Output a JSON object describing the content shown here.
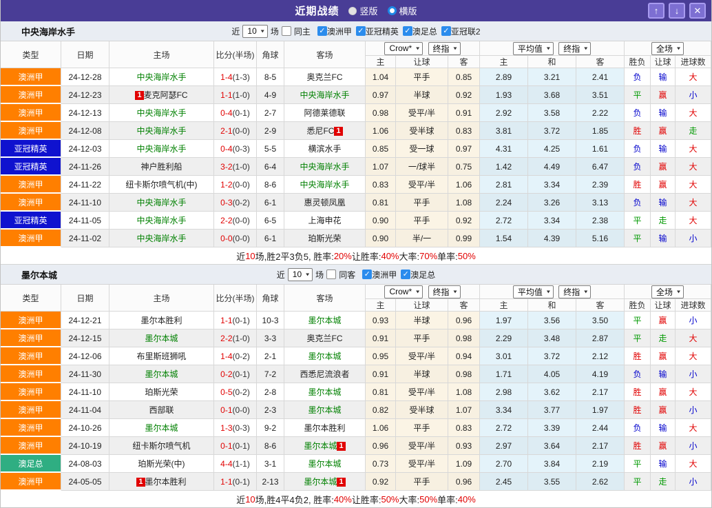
{
  "window": {
    "title": "近期战绩",
    "view_options": [
      {
        "label": "竖版",
        "selected": false
      },
      {
        "label": "横版",
        "selected": true
      }
    ],
    "icons": {
      "up": "↑",
      "down": "↓",
      "close": "✕"
    }
  },
  "table_header": {
    "cols": [
      "类型",
      "日期",
      "主场",
      "比分(半场)",
      "角球",
      "客场"
    ],
    "sub": [
      "主",
      "让球",
      "客",
      "主",
      "和",
      "客",
      "胜负",
      "让球",
      "进球数"
    ],
    "dropdowns": {
      "crow": "Crow*",
      "final1": "终指",
      "avg": "平均值",
      "final2": "终指",
      "full": "全场"
    }
  },
  "sections": [
    {
      "team": "中央海岸水手",
      "filter": {
        "near_label": "近",
        "count": "10",
        "games_label": "场",
        "same_label": "同主",
        "same_checked": false,
        "leagues": [
          {
            "label": "澳洲甲",
            "checked": true
          },
          {
            "label": "亚冠精英",
            "checked": true
          },
          {
            "label": "澳足总",
            "checked": true
          },
          {
            "label": "亚冠联2",
            "checked": true
          }
        ]
      },
      "rows": [
        {
          "lg": "澳洲甲",
          "lc": "orange",
          "date": "24-12-28",
          "h": {
            "n": "中央海岸水手",
            "g": 1
          },
          "s": "1-4",
          "hf": "(1-3)",
          "cn": "8-5",
          "a": {
            "n": "奥克兰FC"
          },
          "od": [
            "1.04",
            "平手",
            "0.85"
          ],
          "av": [
            "2.89",
            "3.21",
            "2.41"
          ],
          "rs": [
            [
              "负",
              "b"
            ],
            [
              "输",
              "b"
            ],
            [
              "大",
              "r"
            ]
          ]
        },
        {
          "lg": "澳洲甲",
          "lc": "orange",
          "date": "24-12-23",
          "h": {
            "n": "麦克阿瑟FC",
            "cb": "1"
          },
          "s": "1-1",
          "hf": "(1-0)",
          "cn": "4-9",
          "a": {
            "n": "中央海岸水手",
            "g": 1
          },
          "od": [
            "0.97",
            "半球",
            "0.92"
          ],
          "av": [
            "1.93",
            "3.68",
            "3.51"
          ],
          "rs": [
            [
              "平",
              "g"
            ],
            [
              "赢",
              "r"
            ],
            [
              "小",
              "b"
            ]
          ]
        },
        {
          "lg": "澳洲甲",
          "lc": "orange",
          "date": "24-12-13",
          "h": {
            "n": "中央海岸水手",
            "g": 1
          },
          "s": "0-4",
          "hf": "(0-1)",
          "cn": "2-7",
          "a": {
            "n": "阿德莱德联"
          },
          "od": [
            "0.98",
            "受平/半",
            "0.91"
          ],
          "av": [
            "2.92",
            "3.58",
            "2.22"
          ],
          "rs": [
            [
              "负",
              "b"
            ],
            [
              "输",
              "b"
            ],
            [
              "大",
              "r"
            ]
          ]
        },
        {
          "lg": "澳洲甲",
          "lc": "orange",
          "date": "24-12-08",
          "h": {
            "n": "中央海岸水手",
            "g": 1
          },
          "s": "2-1",
          "hf": "(0-0)",
          "cn": "2-9",
          "a": {
            "n": "悉尼FC",
            "ca": "1"
          },
          "od": [
            "1.06",
            "受半球",
            "0.83"
          ],
          "av": [
            "3.81",
            "3.72",
            "1.85"
          ],
          "rs": [
            [
              "胜",
              "r"
            ],
            [
              "赢",
              "r"
            ],
            [
              "走",
              "g"
            ]
          ]
        },
        {
          "lg": "亚冠精英",
          "lc": "blue",
          "date": "24-12-03",
          "h": {
            "n": "中央海岸水手",
            "g": 1
          },
          "s": "0-4",
          "hf": "(0-3)",
          "cn": "5-5",
          "a": {
            "n": "横滨水手"
          },
          "od": [
            "0.85",
            "受一球",
            "0.97"
          ],
          "av": [
            "4.31",
            "4.25",
            "1.61"
          ],
          "rs": [
            [
              "负",
              "b"
            ],
            [
              "输",
              "b"
            ],
            [
              "大",
              "r"
            ]
          ]
        },
        {
          "lg": "亚冠精英",
          "lc": "blue",
          "date": "24-11-26",
          "h": {
            "n": "神户胜利船"
          },
          "s": "3-2",
          "hf": "(1-0)",
          "cn": "6-4",
          "a": {
            "n": "中央海岸水手",
            "g": 1
          },
          "od": [
            "1.07",
            "一/球半",
            "0.75"
          ],
          "av": [
            "1.42",
            "4.49",
            "6.47"
          ],
          "rs": [
            [
              "负",
              "b"
            ],
            [
              "赢",
              "r"
            ],
            [
              "大",
              "r"
            ]
          ]
        },
        {
          "lg": "澳洲甲",
          "lc": "orange",
          "date": "24-11-22",
          "h": {
            "n": "纽卡斯尔喷气机(中)"
          },
          "s": "1-2",
          "hf": "(0-0)",
          "cn": "8-6",
          "a": {
            "n": "中央海岸水手",
            "g": 1
          },
          "od": [
            "0.83",
            "受平/半",
            "1.06"
          ],
          "av": [
            "2.81",
            "3.34",
            "2.39"
          ],
          "rs": [
            [
              "胜",
              "r"
            ],
            [
              "赢",
              "r"
            ],
            [
              "大",
              "r"
            ]
          ]
        },
        {
          "lg": "澳洲甲",
          "lc": "orange",
          "date": "24-11-10",
          "h": {
            "n": "中央海岸水手",
            "g": 1
          },
          "s": "0-3",
          "hf": "(0-2)",
          "cn": "6-1",
          "a": {
            "n": "惠灵顿凤凰"
          },
          "od": [
            "0.81",
            "平手",
            "1.08"
          ],
          "av": [
            "2.24",
            "3.26",
            "3.13"
          ],
          "rs": [
            [
              "负",
              "b"
            ],
            [
              "输",
              "b"
            ],
            [
              "大",
              "r"
            ]
          ]
        },
        {
          "lg": "亚冠精英",
          "lc": "blue",
          "date": "24-11-05",
          "h": {
            "n": "中央海岸水手",
            "g": 1
          },
          "s": "2-2",
          "hf": "(0-0)",
          "cn": "6-5",
          "a": {
            "n": "上海申花"
          },
          "od": [
            "0.90",
            "平手",
            "0.92"
          ],
          "av": [
            "2.72",
            "3.34",
            "2.38"
          ],
          "rs": [
            [
              "平",
              "g"
            ],
            [
              "走",
              "g"
            ],
            [
              "大",
              "r"
            ]
          ]
        },
        {
          "lg": "澳洲甲",
          "lc": "orange",
          "date": "24-11-02",
          "h": {
            "n": "中央海岸水手",
            "g": 1
          },
          "s": "0-0",
          "hf": "(0-0)",
          "cn": "6-1",
          "a": {
            "n": "珀斯光荣"
          },
          "od": [
            "0.90",
            "半/一",
            "0.99"
          ],
          "av": [
            "1.54",
            "4.39",
            "5.16"
          ],
          "rs": [
            [
              "平",
              "g"
            ],
            [
              "输",
              "b"
            ],
            [
              "小",
              "b"
            ]
          ]
        }
      ],
      "summary_parts": [
        [
          "近",
          "k"
        ],
        [
          "10",
          "r"
        ],
        [
          "场,胜2平3负5, 胜率:",
          "k"
        ],
        [
          "20%",
          "r"
        ],
        [
          " 让胜率:",
          "k"
        ],
        [
          "40%",
          "r"
        ],
        [
          " 大率:",
          "k"
        ],
        [
          "70%",
          "r"
        ],
        [
          " 单率:",
          "k"
        ],
        [
          "50%",
          "r"
        ]
      ]
    },
    {
      "team": "墨尔本城",
      "filter": {
        "near_label": "近",
        "count": "10",
        "games_label": "场",
        "same_label": "同客",
        "same_checked": false,
        "leagues": [
          {
            "label": "澳洲甲",
            "checked": true
          },
          {
            "label": "澳足总",
            "checked": true
          }
        ]
      },
      "rows": [
        {
          "lg": "澳洲甲",
          "lc": "orange",
          "date": "24-12-21",
          "h": {
            "n": "墨尔本胜利"
          },
          "s": "1-1",
          "hf": "(0-1)",
          "cn": "10-3",
          "a": {
            "n": "墨尔本城",
            "g": 1
          },
          "od": [
            "0.93",
            "半球",
            "0.96"
          ],
          "av": [
            "1.97",
            "3.56",
            "3.50"
          ],
          "rs": [
            [
              "平",
              "g"
            ],
            [
              "赢",
              "r"
            ],
            [
              "小",
              "b"
            ]
          ]
        },
        {
          "lg": "澳洲甲",
          "lc": "orange",
          "date": "24-12-15",
          "h": {
            "n": "墨尔本城",
            "g": 1
          },
          "s": "2-2",
          "hf": "(1-0)",
          "cn": "3-3",
          "a": {
            "n": "奥克兰FC"
          },
          "od": [
            "0.91",
            "平手",
            "0.98"
          ],
          "av": [
            "2.29",
            "3.48",
            "2.87"
          ],
          "rs": [
            [
              "平",
              "g"
            ],
            [
              "走",
              "g"
            ],
            [
              "大",
              "r"
            ]
          ]
        },
        {
          "lg": "澳洲甲",
          "lc": "orange",
          "date": "24-12-06",
          "h": {
            "n": "布里斯班狮吼"
          },
          "s": "1-4",
          "hf": "(0-2)",
          "cn": "2-1",
          "a": {
            "n": "墨尔本城",
            "g": 1
          },
          "od": [
            "0.95",
            "受平/半",
            "0.94"
          ],
          "av": [
            "3.01",
            "3.72",
            "2.12"
          ],
          "rs": [
            [
              "胜",
              "r"
            ],
            [
              "赢",
              "r"
            ],
            [
              "大",
              "r"
            ]
          ]
        },
        {
          "lg": "澳洲甲",
          "lc": "orange",
          "date": "24-11-30",
          "h": {
            "n": "墨尔本城",
            "g": 1
          },
          "s": "0-2",
          "hf": "(0-1)",
          "cn": "7-2",
          "a": {
            "n": "西悉尼流浪者"
          },
          "od": [
            "0.91",
            "半球",
            "0.98"
          ],
          "av": [
            "1.71",
            "4.05",
            "4.19"
          ],
          "rs": [
            [
              "负",
              "b"
            ],
            [
              "输",
              "b"
            ],
            [
              "小",
              "b"
            ]
          ]
        },
        {
          "lg": "澳洲甲",
          "lc": "orange",
          "date": "24-11-10",
          "h": {
            "n": "珀斯光荣"
          },
          "s": "0-5",
          "hf": "(0-2)",
          "cn": "2-8",
          "a": {
            "n": "墨尔本城",
            "g": 1
          },
          "od": [
            "0.81",
            "受平/半",
            "1.08"
          ],
          "av": [
            "2.98",
            "3.62",
            "2.17"
          ],
          "rs": [
            [
              "胜",
              "r"
            ],
            [
              "赢",
              "r"
            ],
            [
              "大",
              "r"
            ]
          ]
        },
        {
          "lg": "澳洲甲",
          "lc": "orange",
          "date": "24-11-04",
          "h": {
            "n": "西部联"
          },
          "s": "0-1",
          "hf": "(0-0)",
          "cn": "2-3",
          "a": {
            "n": "墨尔本城",
            "g": 1
          },
          "od": [
            "0.82",
            "受半球",
            "1.07"
          ],
          "av": [
            "3.34",
            "3.77",
            "1.97"
          ],
          "rs": [
            [
              "胜",
              "r"
            ],
            [
              "赢",
              "r"
            ],
            [
              "小",
              "b"
            ]
          ]
        },
        {
          "lg": "澳洲甲",
          "lc": "orange",
          "date": "24-10-26",
          "h": {
            "n": "墨尔本城",
            "g": 1
          },
          "s": "1-3",
          "hf": "(0-3)",
          "cn": "9-2",
          "a": {
            "n": "墨尔本胜利"
          },
          "od": [
            "1.06",
            "平手",
            "0.83"
          ],
          "av": [
            "2.72",
            "3.39",
            "2.44"
          ],
          "rs": [
            [
              "负",
              "b"
            ],
            [
              "输",
              "b"
            ],
            [
              "大",
              "r"
            ]
          ]
        },
        {
          "lg": "澳洲甲",
          "lc": "orange",
          "date": "24-10-19",
          "h": {
            "n": "纽卡斯尔喷气机"
          },
          "s": "0-1",
          "hf": "(0-1)",
          "cn": "8-6",
          "a": {
            "n": "墨尔本城",
            "g": 1,
            "ca": "1"
          },
          "od": [
            "0.96",
            "受平/半",
            "0.93"
          ],
          "av": [
            "2.97",
            "3.64",
            "2.17"
          ],
          "rs": [
            [
              "胜",
              "r"
            ],
            [
              "赢",
              "r"
            ],
            [
              "小",
              "b"
            ]
          ]
        },
        {
          "lg": "澳足总",
          "lc": "green",
          "date": "24-08-03",
          "h": {
            "n": "珀斯光荣(中)"
          },
          "s": "4-4",
          "hf": "(1-1)",
          "cn": "3-1",
          "a": {
            "n": "墨尔本城",
            "g": 1
          },
          "od": [
            "0.73",
            "受平/半",
            "1.09"
          ],
          "av": [
            "2.70",
            "3.84",
            "2.19"
          ],
          "rs": [
            [
              "平",
              "g"
            ],
            [
              "输",
              "b"
            ],
            [
              "大",
              "r"
            ]
          ]
        },
        {
          "lg": "澳洲甲",
          "lc": "orange",
          "date": "24-05-05",
          "h": {
            "n": "墨尔本胜利",
            "cb": "1"
          },
          "s": "1-1",
          "hf": "(0-1)",
          "cn": "2-13",
          "a": {
            "n": "墨尔本城",
            "g": 1,
            "ca": "1"
          },
          "od": [
            "0.92",
            "平手",
            "0.96"
          ],
          "av": [
            "2.45",
            "3.55",
            "2.62"
          ],
          "rs": [
            [
              "平",
              "g"
            ],
            [
              "走",
              "g"
            ],
            [
              "小",
              "b"
            ]
          ]
        }
      ],
      "summary_parts": [
        [
          "近",
          "k"
        ],
        [
          "10",
          "r"
        ],
        [
          "场,胜4平4负2, 胜率:",
          "k"
        ],
        [
          "40%",
          "r"
        ],
        [
          " 让胜率:",
          "k"
        ],
        [
          "50%",
          "r"
        ],
        [
          " 大率:",
          "k"
        ],
        [
          "50%",
          "r"
        ],
        [
          " 单率:",
          "k"
        ],
        [
          "40%",
          "r"
        ]
      ]
    }
  ],
  "colors": {
    "titlebar": "#493d96",
    "league_orange": "#ff7f00",
    "league_blue": "#0f12cf",
    "league_green": "#2fae82",
    "focus_team": "#008000",
    "win": "#e10000",
    "draw": "#009900",
    "lose": "#0000cc",
    "checkbox": "#2b8ced"
  }
}
